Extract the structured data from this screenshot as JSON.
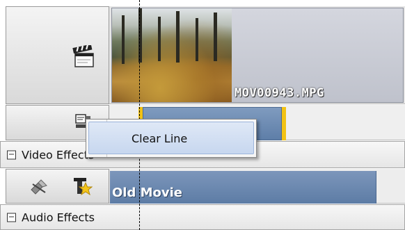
{
  "timeline": {
    "video_track": {
      "clip_filename": "MOV00943.MPG",
      "icon": "clapperboard-icon"
    },
    "audio_track": {
      "icon": "audio-track-icon"
    },
    "video_effects": {
      "label": "Video Effects",
      "expander": "collapse-icon"
    },
    "effect_track": {
      "effect_name": "Old Movie",
      "icons": [
        "effect-remove-icon",
        "effect-star-icon"
      ]
    },
    "audio_effects": {
      "label": "Audio Effects",
      "expander": "collapse-icon"
    }
  },
  "context_menu": {
    "items": [
      {
        "label": "Clear Line"
      }
    ]
  },
  "colors": {
    "clip_blue": "#6a89b3",
    "clip_edge_yellow": "#f2c214",
    "menu_highlight": "#c7d7ef"
  }
}
